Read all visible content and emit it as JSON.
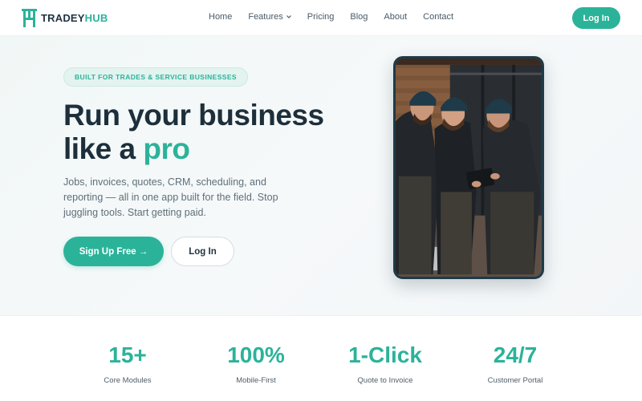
{
  "brand": {
    "name_prefix": "TRADEY",
    "name_suffix": "HUB",
    "accent_color": "#2bb39a",
    "dark_color": "#1d2f3b"
  },
  "nav": {
    "items": [
      {
        "label": "Home"
      },
      {
        "label": "Features",
        "has_dropdown": true
      },
      {
        "label": "Pricing"
      },
      {
        "label": "Blog"
      },
      {
        "label": "About"
      },
      {
        "label": "Contact"
      }
    ],
    "login_label": "Log In"
  },
  "hero": {
    "badge": "BUILT FOR TRADES & SERVICE BUSINESSES",
    "headline_line1": "Run your business",
    "headline_line2_prefix": "like a ",
    "headline_highlight": "pro",
    "subtext": "Jobs, invoices, quotes, CRM, scheduling, and reporting — all in one app built for the field. Stop juggling tools. Start getting paid.",
    "signup_label": "Sign Up Free →",
    "login_label": "Log In",
    "image_icon": "workers-photo"
  },
  "stats": [
    {
      "value": "15+",
      "label": "Core Modules"
    },
    {
      "value": "100%",
      "label": "Mobile-First"
    },
    {
      "value": "1-Click",
      "label": "Quote to Invoice"
    },
    {
      "value": "24/7",
      "label": "Customer Portal"
    }
  ]
}
